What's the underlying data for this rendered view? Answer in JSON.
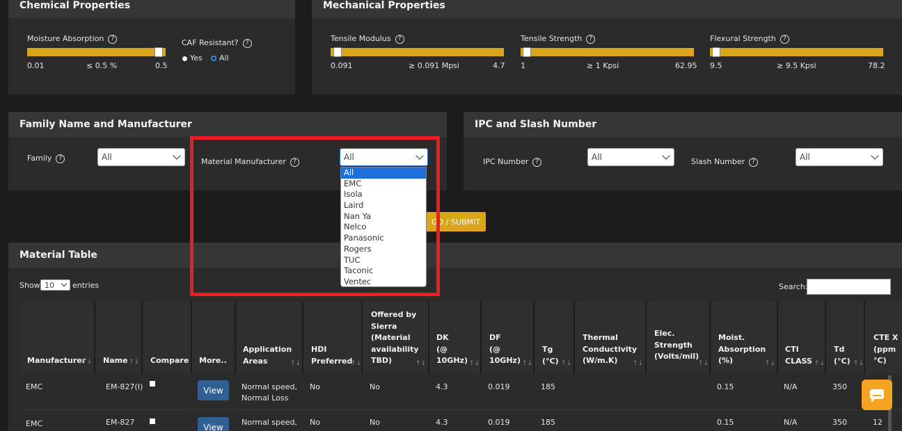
{
  "chemical": {
    "title": "Chemical Properties",
    "moisture_label": "Moisture Absorption",
    "moisture_min": "0.01",
    "moisture_value": "≤ 0.5 %",
    "moisture_max": "0.5",
    "caf_label": "CAF Resistant?",
    "caf_yes": "Yes",
    "caf_all": "All"
  },
  "mechanical": {
    "title": "Mechanical Properties",
    "tensile_modulus_label": "Tensile Modulus",
    "tensile_modulus_min": "0.091",
    "tensile_modulus_value": "≥ 0.091 Mpsi",
    "tensile_modulus_max": "4.7",
    "tensile_strength_label": "Tensile Strength",
    "tensile_strength_min": "1",
    "tensile_strength_value": "≥ 1 Kpsi",
    "tensile_strength_max": "62.95",
    "flexural_strength_label": "Flexural Strength",
    "flexural_strength_min": "9.5",
    "flexural_strength_value": "≥ 9.5  Kpsi",
    "flexural_strength_max": "78.2"
  },
  "family": {
    "title": "Family Name and Manufacturer",
    "family_label": "Family",
    "family_value": "All",
    "manufacturer_label": "Material Manufacturer",
    "manufacturer_value": "All",
    "manufacturer_options": [
      "All",
      "EMC",
      "Isola",
      "Laird",
      "Nan Ya",
      "Nelco",
      "Panasonic",
      "Rogers",
      "TUC",
      "Taconic",
      "Ventec"
    ]
  },
  "ipc": {
    "title": "IPC and Slash Number",
    "ipc_label": "IPC Number",
    "ipc_value": "All",
    "slash_label": "Slash Number",
    "slash_value": "All"
  },
  "submit_label": "GO / SUBMIT",
  "table": {
    "title": "Material Table",
    "show": "Show",
    "entries_value": "10",
    "entries": "entries",
    "search": "Search:",
    "headers": {
      "manufacturer": "Manufacturer",
      "name": "Name",
      "compare": "Compare",
      "more": "More..",
      "app_1": "Application",
      "app_2": "Areas",
      "hdi_1": "HDI",
      "hdi_2": "Preferred",
      "off_1": "Offered by",
      "off_2": "Sierra",
      "off_3": "(Material",
      "off_4": "availability",
      "off_5": "TBD)",
      "dk_1": "DK",
      "dk_2": "(@",
      "dk_3": "10GHz)",
      "df_1": "DF",
      "df_2": "(@",
      "df_3": "10GHz)",
      "tg_1": "Tg",
      "tg_2": "(°C)",
      "tc_1": "Thermal",
      "tc_2": "Conductivity",
      "tc_3": "(W/m.K)",
      "es_1": "Elec.",
      "es_2": "Strength",
      "es_3": "(Volts/mil)",
      "ma_1": "Moist.",
      "ma_2": "Absorption",
      "ma_3": "(%)",
      "cti_1": "CTI",
      "cti_2": "CLASS",
      "td_1": "Td",
      "td_2": "(°C)",
      "cte_1": "CTE X",
      "cte_2": "(ppm",
      "cte_3": "°C)"
    },
    "rows": [
      {
        "manufacturer": "EMC",
        "name": "EM-827(I)",
        "more": "View",
        "app_1": "Normal speed,",
        "app_2": "Normal Loss",
        "hdi": "No",
        "offered": "No",
        "dk": "4.3",
        "df": "0.019",
        "tg": "185",
        "moist": "0.15",
        "cti": "N/A",
        "td": "350",
        "cte": ""
      },
      {
        "manufacturer": "EMC",
        "name": "EM-827",
        "more": "View",
        "app_1": "Normal speed,",
        "app_2": "",
        "hdi": "No",
        "offered": "No",
        "dk": "4.3",
        "df": "0.019",
        "tg": "185",
        "moist": "0.15",
        "cti": "N/A",
        "td": "350",
        "cte": "12"
      }
    ]
  }
}
